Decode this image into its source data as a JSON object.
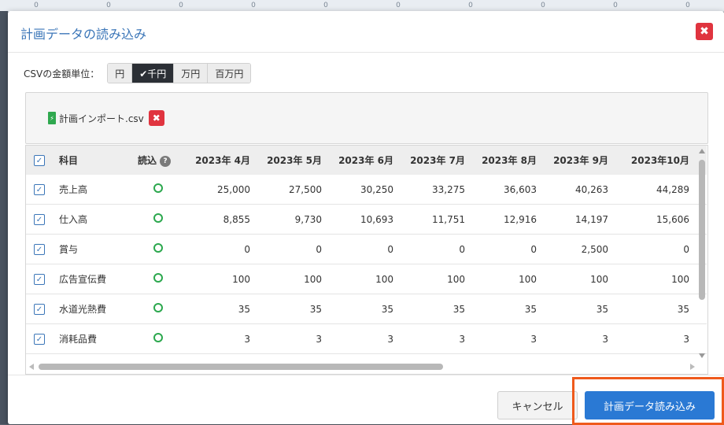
{
  "modal": {
    "title": "計画データの読み込み",
    "close_glyph": "✖"
  },
  "unit": {
    "label": "CSVの金額単位：",
    "options": [
      {
        "label": "円",
        "active": false
      },
      {
        "label": "✔千円",
        "active": true
      },
      {
        "label": "万円",
        "active": false
      },
      {
        "label": "百万円",
        "active": false
      }
    ]
  },
  "file": {
    "name": "計画インポート.csv",
    "remove_glyph": "✖"
  },
  "grid": {
    "headers": {
      "item": "科目",
      "import": "読込",
      "months": [
        "2023年 4月",
        "2023年 5月",
        "2023年 6月",
        "2023年 7月",
        "2023年 8月",
        "2023年 9月",
        "2023年10月"
      ]
    },
    "rows": [
      {
        "name": "売上高",
        "values": [
          "25,000",
          "27,500",
          "30,250",
          "33,275",
          "36,603",
          "40,263",
          "44,289"
        ]
      },
      {
        "name": "仕入高",
        "values": [
          "8,855",
          "9,730",
          "10,693",
          "11,751",
          "12,916",
          "14,197",
          "15,606"
        ]
      },
      {
        "name": "賞与",
        "values": [
          "0",
          "0",
          "0",
          "0",
          "0",
          "2,500",
          "0"
        ]
      },
      {
        "name": "広告宣伝費",
        "values": [
          "100",
          "100",
          "100",
          "100",
          "100",
          "100",
          "100"
        ]
      },
      {
        "name": "水道光熱費",
        "values": [
          "35",
          "35",
          "35",
          "35",
          "35",
          "35",
          "35"
        ]
      },
      {
        "name": "消耗品費",
        "values": [
          "3",
          "3",
          "3",
          "3",
          "3",
          "3",
          "3"
        ]
      }
    ]
  },
  "footer": {
    "cancel_label": "キャンセル",
    "import_label": "計画データ読み込み"
  },
  "colors": {
    "title": "#3b76b8",
    "primary": "#2a79d4",
    "danger": "#e0343f",
    "ok_circle": "#2ca84e",
    "highlight": "#ef5a1c"
  }
}
